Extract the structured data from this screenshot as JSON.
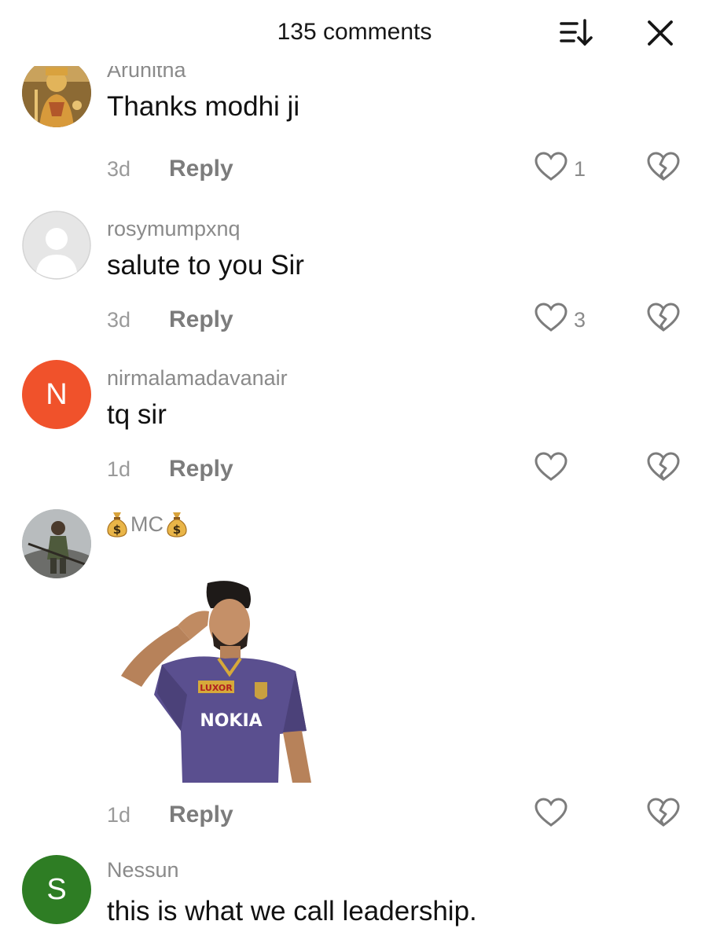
{
  "header": {
    "title": "135 comments",
    "sort_icon": "sort-icon",
    "close_icon": "close-icon"
  },
  "comments": [
    {
      "username": "Arunitha",
      "text": "Thanks modhi ji",
      "time": "3d",
      "reply_label": "Reply",
      "likes": "1",
      "avatar_type": "image"
    },
    {
      "username": "rosymumpxnq",
      "text": "salute to you Sir",
      "time": "3d",
      "reply_label": "Reply",
      "likes": "3",
      "avatar_type": "default"
    },
    {
      "username": "nirmalamadavanair",
      "text": "tq sir",
      "time": "1d",
      "reply_label": "Reply",
      "likes": "",
      "avatar_type": "letter",
      "avatar_letter": "N",
      "avatar_color": "#f0522b"
    },
    {
      "username": "MC",
      "username_emoji": "money-bag-icon",
      "time": "1d",
      "reply_label": "Reply",
      "likes": "",
      "avatar_type": "image",
      "sticker": {
        "jersey_text": "NOKIA",
        "jersey_sponsor": "LUXOR"
      }
    },
    {
      "username": "Nessun",
      "text": "this is what we call leadership.",
      "avatar_type": "letter",
      "avatar_letter": "S",
      "avatar_color": "#2e7d24"
    }
  ],
  "colors": {
    "username": "#8a8a8a",
    "text": "#111111",
    "muted": "#9a9a9a"
  }
}
